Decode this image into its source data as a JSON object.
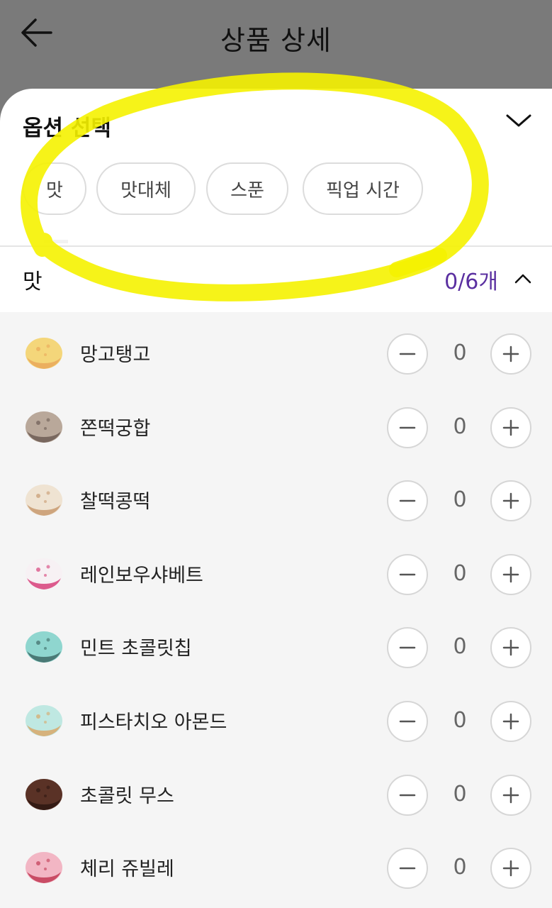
{
  "header": {
    "title": "상품 상세",
    "back_icon": "arrow-left-icon"
  },
  "options": {
    "title": "옵션 선택",
    "collapse_icon": "chevron-down-icon",
    "chips": [
      "맛",
      "맛대체",
      "스푼",
      "픽업 시간"
    ]
  },
  "section": {
    "label": "맛",
    "count": "0/6개",
    "toggle_icon": "chevron-up-icon"
  },
  "flavors": [
    {
      "name": "망고탱고",
      "qty": "0",
      "colors": [
        "#f4d67a",
        "#e9a85a"
      ]
    },
    {
      "name": "쫀떡궁합",
      "qty": "0",
      "colors": [
        "#b9a89a",
        "#6d5d55"
      ]
    },
    {
      "name": "찰떡콩떡",
      "qty": "0",
      "colors": [
        "#efe3d2",
        "#c89a70"
      ]
    },
    {
      "name": "레인보우샤베트",
      "qty": "0",
      "colors": [
        "#f7f1f4",
        "#d7417a"
      ]
    },
    {
      "name": "민트 초콜릿칩",
      "qty": "0",
      "colors": [
        "#8fd6cf",
        "#3e6a66"
      ]
    },
    {
      "name": "피스타치오 아몬드",
      "qty": "0",
      "colors": [
        "#bfe8e2",
        "#d9a86a"
      ]
    },
    {
      "name": "초콜릿 무스",
      "qty": "0",
      "colors": [
        "#5a3226",
        "#2e1812"
      ]
    },
    {
      "name": "체리 쥬빌레",
      "qty": "0",
      "colors": [
        "#f2b6c4",
        "#c23a55"
      ]
    }
  ],
  "colors": {
    "overlay": "#7a7a7a",
    "accent": "#5a2fa0",
    "highlight": "#f5f200",
    "list_bg": "#f5f5f5"
  }
}
